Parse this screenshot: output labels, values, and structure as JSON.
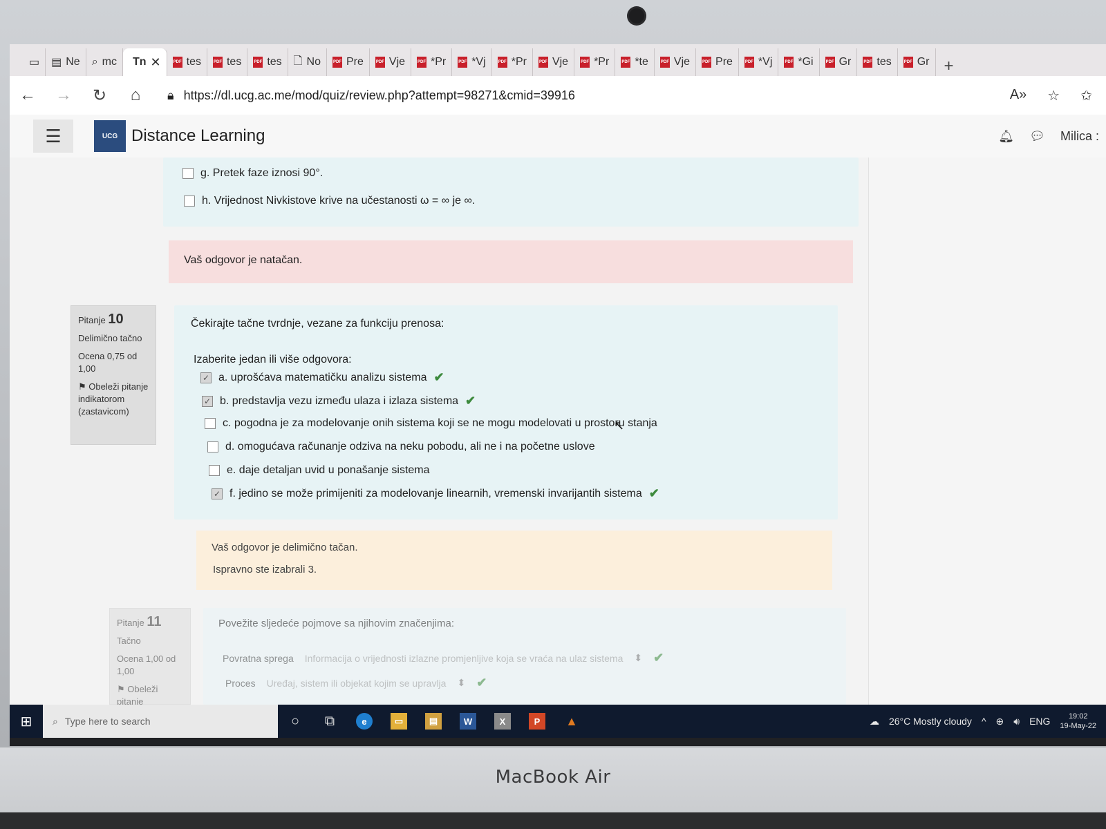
{
  "device": {
    "brand": "MacBook Air"
  },
  "tabs": [
    {
      "label": "Ne",
      "icon": "window-icon"
    },
    {
      "label": "mc",
      "icon": "search-icon"
    },
    {
      "label": "Tn",
      "icon": "text-icon",
      "active": true
    },
    {
      "label": "tes",
      "icon": "pdf-icon"
    },
    {
      "label": "tes",
      "icon": "pdf-icon"
    },
    {
      "label": "tes",
      "icon": "pdf-icon"
    },
    {
      "label": "No",
      "icon": "document-icon"
    },
    {
      "label": "Pre",
      "icon": "pdf-icon"
    },
    {
      "label": "Vje",
      "icon": "pdf-icon"
    },
    {
      "label": "*Pr",
      "icon": "pdf-icon"
    },
    {
      "label": "*Vj",
      "icon": "pdf-icon"
    },
    {
      "label": "*Pr",
      "icon": "pdf-icon"
    },
    {
      "label": "Vje",
      "icon": "pdf-icon"
    },
    {
      "label": "*Pr",
      "icon": "pdf-icon"
    },
    {
      "label": "*te",
      "icon": "pdf-icon"
    },
    {
      "label": "Vje",
      "icon": "pdf-icon"
    },
    {
      "label": "Pre",
      "icon": "pdf-icon"
    },
    {
      "label": "*Vj",
      "icon": "pdf-icon"
    },
    {
      "label": "*Gi",
      "icon": "pdf-icon"
    },
    {
      "label": "Gr",
      "icon": "pdf-icon"
    },
    {
      "label": "tes",
      "icon": "pdf-icon"
    },
    {
      "label": "Gr",
      "icon": "pdf-icon"
    }
  ],
  "address": {
    "url": "https://dl.ucg.ac.me/mod/quiz/review.php?attempt=98271&cmid=39916"
  },
  "header": {
    "site_name": "Distance Learning",
    "logo_text": "UCG",
    "user": "Milica :"
  },
  "previous_question": {
    "options": [
      {
        "text": "g. Pretek faze iznosi 90°."
      },
      {
        "text": "h. Vrijednost Nivkistove krive na učestanosti ω = ∞ je ∞."
      }
    ],
    "feedback": "Vaš odgovor je natačan."
  },
  "q10": {
    "label": "Pitanje",
    "number": "10",
    "state": "Delimično tačno",
    "grade": "Ocena 0,75 od 1,00",
    "flag": "Obeleži pitanje indikatorom (zastavicom)",
    "prompt": "Čekirajte tačne tvrdnje, vezane za funkciju prenosa:",
    "instruction": "Izaberite jedan ili više odgovora:",
    "options": [
      {
        "text": "a. uprošćava matematičku analizu sistema",
        "checked": true,
        "correct": true
      },
      {
        "text": "b. predstavlja vezu između ulaza i izlaza sistema",
        "checked": true,
        "correct": true
      },
      {
        "text": "c. pogodna je za modelovanje onih sistema koji se ne mogu modelovati u prostoru stanja",
        "checked": false,
        "correct": false
      },
      {
        "text": "d. omogućava računanje odziva na neku pobodu, ali ne i na početne uslove",
        "checked": false,
        "correct": false
      },
      {
        "text": "e. daje detaljan uvid u ponašanje sistema",
        "checked": false,
        "correct": false
      },
      {
        "text": "f. jedino se može primijeniti za modelovanje linearnih, vremenski invarijantih sistema",
        "checked": true,
        "correct": true
      }
    ],
    "feedback": "Vaš odgovor je delimično tačan.",
    "feedback2": "Ispravno ste izabrali 3."
  },
  "q11": {
    "label": "Pitanje",
    "number": "11",
    "state": "Tačno",
    "grade": "Ocena 1,00 od 1,00",
    "flag": "Obeleži pitanje",
    "prompt": "Povežite sljedeće pojmove sa njihovim značenjima:",
    "rows": [
      {
        "term": "Povratna sprega",
        "answer": "Informacija o vrijednosti izlazne promjenljive koja se vraća na ulaz sistema"
      },
      {
        "term": "Proces",
        "answer": "Uređaj, sistem ili objekat kojim se upravlja"
      }
    ]
  },
  "taskbar": {
    "search_placeholder": "Type here to search",
    "weather": "26°C  Mostly cloudy",
    "lang": "ENG",
    "time": "19:02",
    "date": "19-May-22",
    "apps": [
      "task-view-icon",
      "edge-icon",
      "file-explorer-icon",
      "store-icon",
      "word-icon",
      "excel-icon",
      "powerpoint-icon",
      "matlab-icon"
    ]
  },
  "colors": {
    "question_bg": "#e7f3f5",
    "feedback_bg": "#fcefdc",
    "correct_tick": "#3d8a3d",
    "taskbar": "#0f1a2e"
  }
}
